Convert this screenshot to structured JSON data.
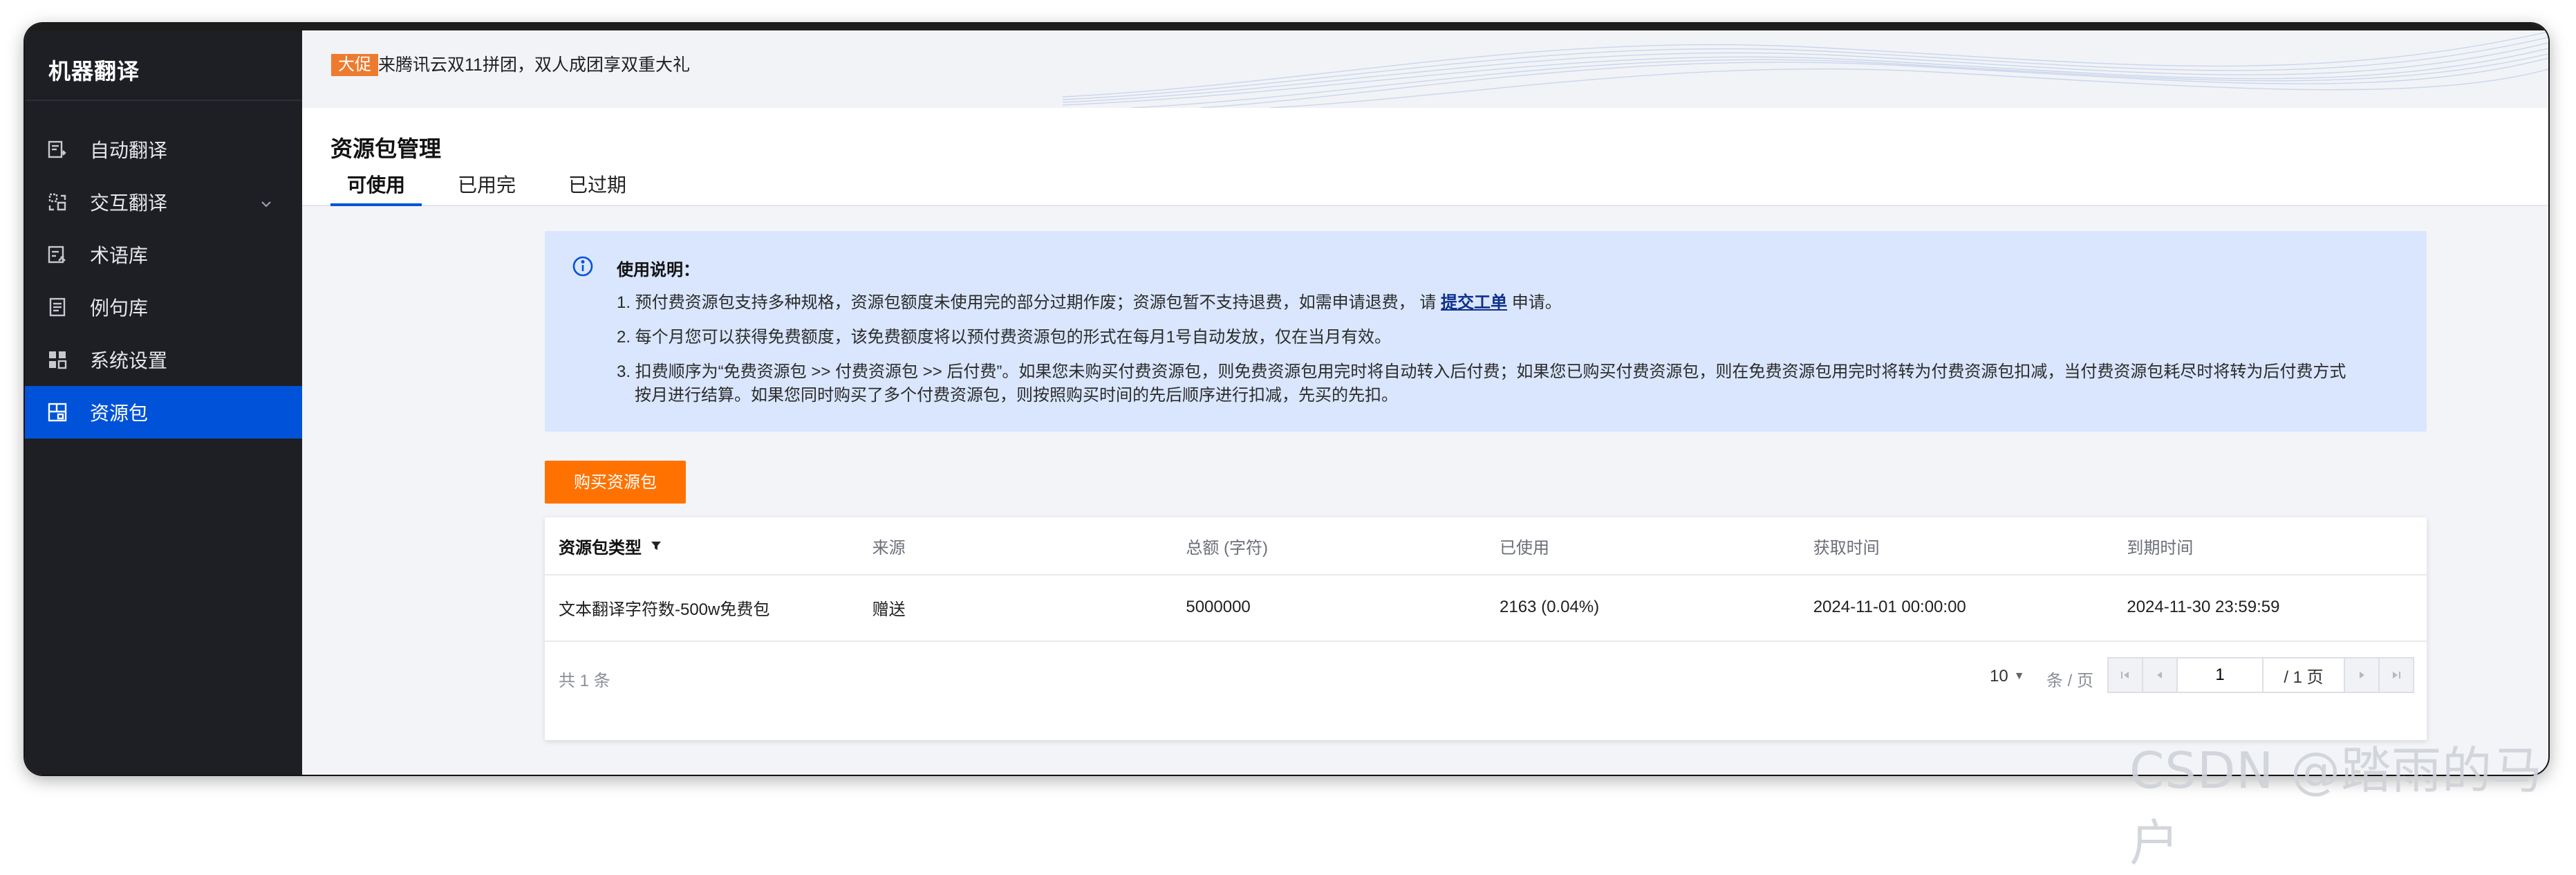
{
  "sidebar": {
    "title": "机器翻译",
    "items": [
      {
        "label": "自动翻译",
        "icon": "auto-translate-icon"
      },
      {
        "label": "交互翻译",
        "icon": "interactive-translate-icon"
      },
      {
        "label": "术语库",
        "icon": "glossary-icon"
      },
      {
        "label": "例句库",
        "icon": "sentence-library-icon"
      },
      {
        "label": "系统设置",
        "icon": "settings-grid-icon"
      },
      {
        "label": "资源包",
        "icon": "resource-package-icon",
        "active": true
      }
    ]
  },
  "banner": {
    "badge": "大促",
    "text": "来腾讯云双11拼团，双人成团享双重大礼"
  },
  "header": {
    "title": "资源包管理",
    "tabs": [
      "可使用",
      "已用完",
      "已过期"
    ],
    "active_tab": 0
  },
  "notice": {
    "title": "使用说明：",
    "line1_pre": "1. 预付费资源包支持多种规格，资源包额度未使用完的部分过期作废；资源包暂不支持退费，如需申请退费， 请 ",
    "line1_link": "提交工单",
    "line1_post": " 申请。",
    "line2": "2. 每个月您可以获得免费额度，该免费额度将以预付费资源包的形式在每月1号自动发放，仅在当月有效。",
    "line3a": "3. 扣费顺序为“免费资源包 >> 付费资源包 >> 后付费”。如果您未购买付费资源包，则免费资源包用完时将自动转入后付费；如果您已购买付费资源包，则在免费资源包用完时将转为付费资源包扣减，当付费资源包耗尽时将转为后付费方式",
    "line3b": "按月进行结算。如果您同时购买了多个付费资源包，则按照购买时间的先后顺序进行扣减，先买的先扣。"
  },
  "buy_button": "购买资源包",
  "table": {
    "columns": [
      "资源包类型",
      "来源",
      "总额 (字符)",
      "已使用",
      "获取时间",
      "到期时间"
    ],
    "rows": [
      [
        "文本翻译字符数-500w免费包",
        "赠送",
        "5000000",
        "2163 (0.04%)",
        "2024-11-01 00:00:00",
        "2024-11-30 23:59:59"
      ]
    ]
  },
  "pagination": {
    "total": "共 1 条",
    "page_size": "10",
    "per_page_label": "条 / 页",
    "current_page": "1",
    "total_pages": "/ 1 页"
  },
  "watermark": "CSDN @踏雨的马户",
  "colors": {
    "sidebar_bg": "#1d1f24",
    "active_nav": "#0052d9",
    "badge": "#ed7b2f",
    "buy_button": "#ff7200",
    "notice_bg": "#d9e6fd"
  }
}
